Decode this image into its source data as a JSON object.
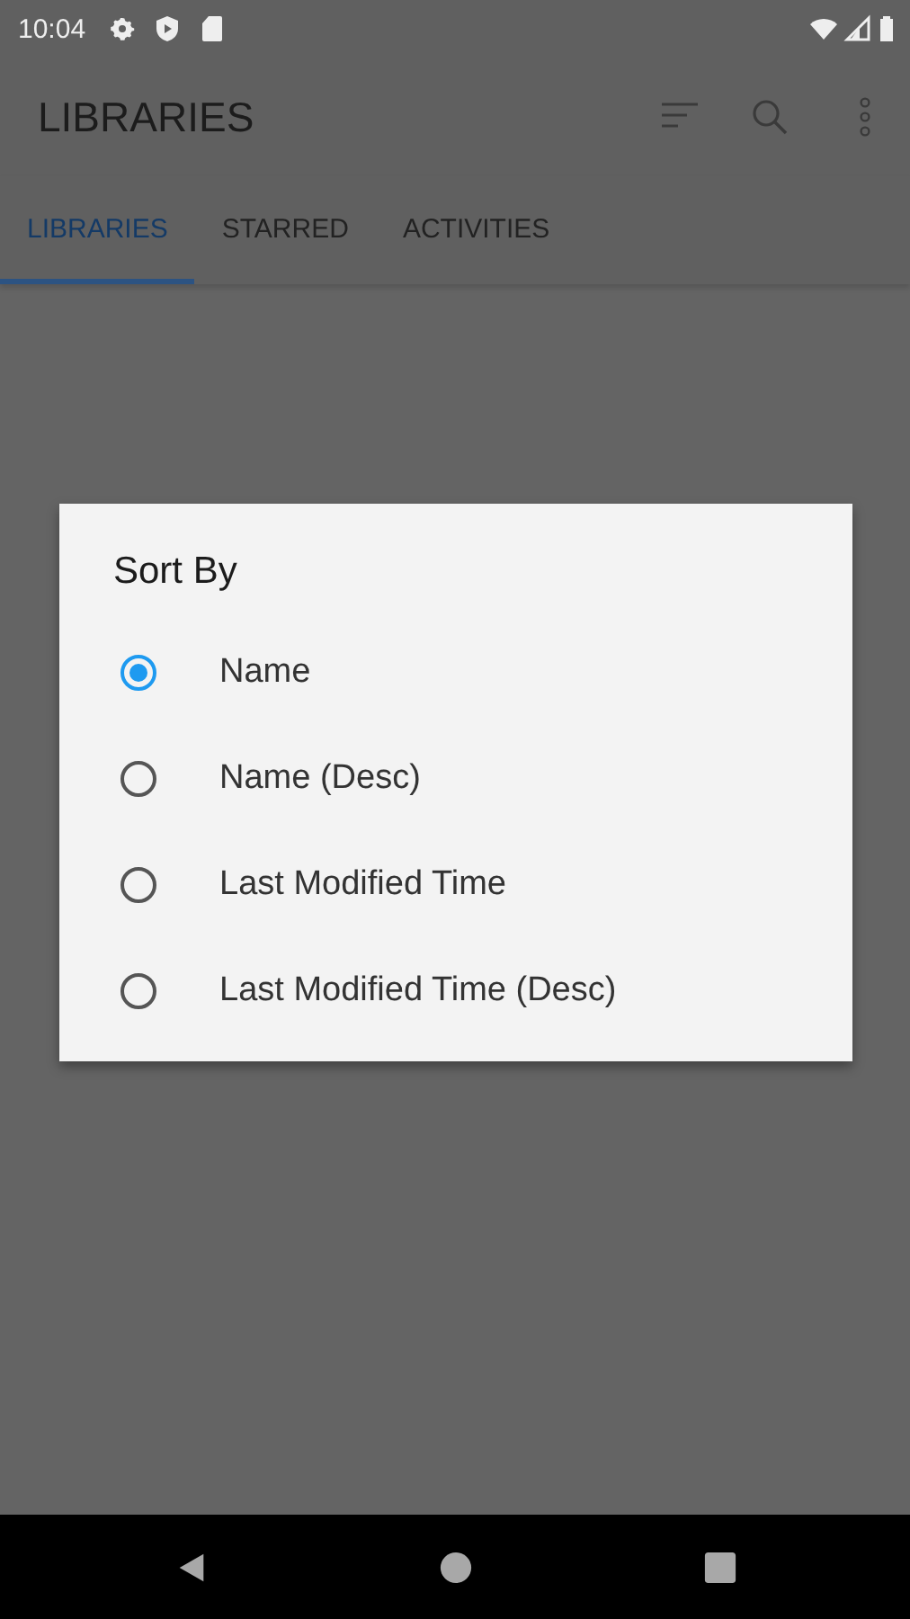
{
  "status_bar": {
    "time": "10:04"
  },
  "app_bar": {
    "title": "LIBRARIES"
  },
  "tabs": [
    {
      "label": "LIBRARIES",
      "selected": true
    },
    {
      "label": "STARRED",
      "selected": false
    },
    {
      "label": "ACTIVITIES",
      "selected": false
    }
  ],
  "dialog": {
    "title": "Sort By",
    "options": [
      {
        "label": "Name",
        "selected": true
      },
      {
        "label": "Name (Desc)",
        "selected": false
      },
      {
        "label": "Last Modified Time",
        "selected": false
      },
      {
        "label": "Last Modified Time (Desc)",
        "selected": false
      }
    ]
  }
}
